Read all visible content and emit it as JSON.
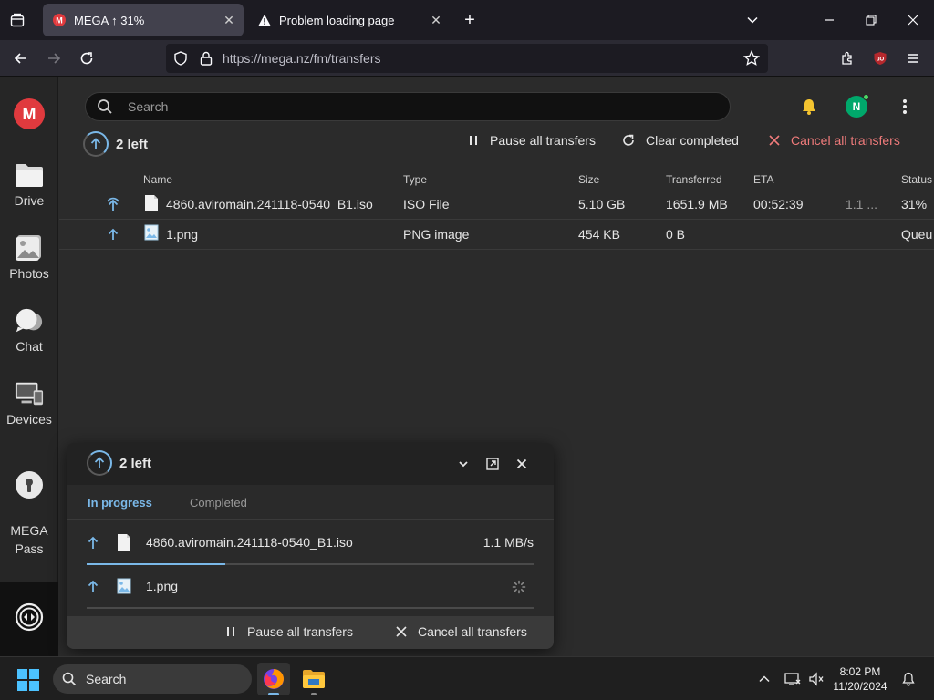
{
  "browser": {
    "tabs": [
      {
        "title": "MEGA ↑ 31%",
        "active": true
      },
      {
        "title": "Problem loading page",
        "active": false
      }
    ],
    "url": "https://mega.nz/fm/transfers"
  },
  "sidebar": {
    "logo": "M",
    "items": [
      {
        "label": "Drive",
        "icon": "drive-icon"
      },
      {
        "label": "Photos",
        "icon": "photos-icon"
      },
      {
        "label": "Chat",
        "icon": "chat-icon"
      },
      {
        "label": "Devices",
        "icon": "devices-icon"
      },
      {
        "label": "MEGA\nPass",
        "icon": "mega-pass-icon"
      }
    ]
  },
  "header": {
    "search_placeholder": "Search",
    "avatar_initial": "N"
  },
  "transfers": {
    "left_count": "2 left",
    "pause_all": "Pause all transfers",
    "clear_completed": "Clear completed",
    "cancel_all": "Cancel all transfers",
    "columns": [
      "Name",
      "Type",
      "Size",
      "Transferred",
      "ETA",
      "Status"
    ],
    "rows": [
      {
        "name": "4860.aviromain.241118-0540_B1.iso",
        "type": "ISO File",
        "size": "5.10 GB",
        "transferred": "1651.9 MB",
        "eta": "00:52:39",
        "speed": "1.1 ...",
        "status": "31%"
      },
      {
        "name": "1.png",
        "type": "PNG image",
        "size": "454 KB",
        "transferred": "0 B",
        "eta": "",
        "speed": "",
        "status": "Queu"
      }
    ]
  },
  "widget": {
    "left_count": "2 left",
    "tab_in_progress": "In progress",
    "tab_completed": "Completed",
    "rows": [
      {
        "name": "4860.aviromain.241118-0540_B1.iso",
        "speed": "1.1 MB/s",
        "progress": 0.31
      },
      {
        "name": "1.png",
        "speed": "",
        "progress": 0
      }
    ],
    "pause_all": "Pause all transfers",
    "cancel_all": "Cancel all transfers"
  },
  "taskbar": {
    "search_label": "Search",
    "time": "8:02 PM",
    "date": "11/20/2024"
  },
  "colors": {
    "accent": "#7ab8e8",
    "mega_red": "#e03a3e",
    "cancel": "#f07b7b"
  }
}
